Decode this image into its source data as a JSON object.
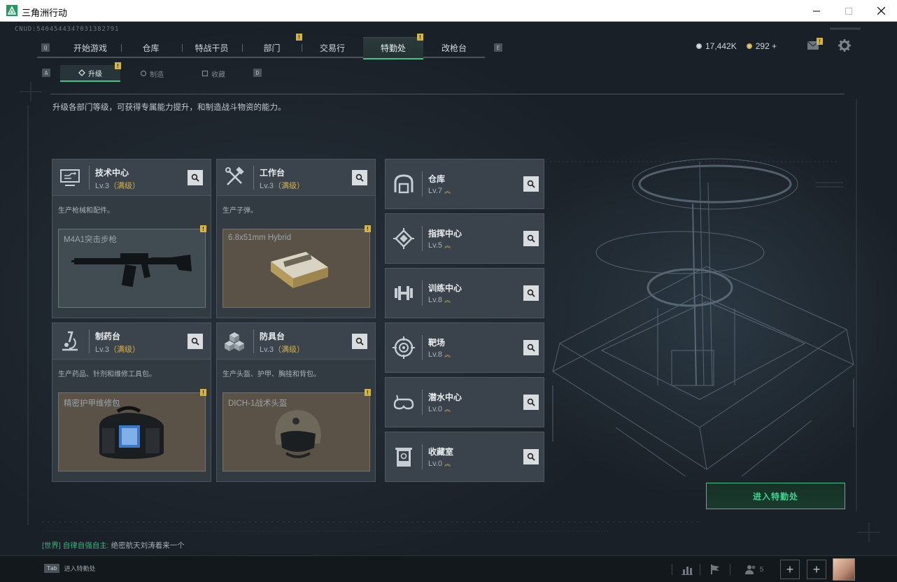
{
  "window": {
    "title": "三角洲行动"
  },
  "header": {
    "cnud": "CNUD:540454434703138279​1",
    "nav_key_left": "Q",
    "nav_key_right": "E",
    "tabs": [
      {
        "label": "开始游戏",
        "active": false,
        "alert": false
      },
      {
        "label": "仓库",
        "active": false,
        "alert": false
      },
      {
        "label": "特战干员",
        "active": false,
        "alert": false
      },
      {
        "label": "部门",
        "active": false,
        "alert": true
      },
      {
        "label": "交易行",
        "active": false,
        "alert": false
      },
      {
        "label": "特勤处",
        "active": true,
        "alert": true
      },
      {
        "label": "改枪台",
        "active": false,
        "alert": false
      }
    ],
    "currency_silver": "17,442K",
    "currency_gold": "292",
    "currency_plus": "+",
    "alert_glyph": "!"
  },
  "subnav": {
    "key_left": "A",
    "key_right": "D",
    "tabs": [
      {
        "label": "升级",
        "active": true
      },
      {
        "label": "制造",
        "active": false
      },
      {
        "label": "收藏",
        "active": false
      }
    ]
  },
  "intro": "升级各部门等级，可获得专属能力提升，和制造战斗物资的能力。",
  "departments": [
    {
      "name": "技术中心",
      "level": "Lv.3",
      "maxed": "（满级）",
      "desc": "生产枪械和配件。",
      "product": "M4A1突击步枪",
      "icon": "monitor-circuit-icon",
      "product_icon": "rifle-icon"
    },
    {
      "name": "工作台",
      "level": "Lv.3",
      "maxed": "（满级）",
      "desc": "生产子弹。",
      "product": "6.8x51mm Hybrid",
      "icon": "hammer-wrench-icon",
      "product_icon": "ammo-box-icon"
    },
    {
      "name": "制药台",
      "level": "Lv.3",
      "maxed": "（满级）",
      "desc": "生产药品、针剂和维修工具包。",
      "product": "精密护甲维修包",
      "icon": "microscope-icon",
      "product_icon": "repair-kit-icon"
    },
    {
      "name": "防具台",
      "level": "Lv.3",
      "maxed": "（满级）",
      "desc": "生产头盔、护甲、胸挂和背包。",
      "product": "DICH-1战术头盔",
      "icon": "armor-cubes-icon",
      "product_icon": "helmet-icon"
    }
  ],
  "rooms": [
    {
      "name": "仓库",
      "level": "Lv.7",
      "icon": "storage-arch-icon"
    },
    {
      "name": "指挥中心",
      "level": "Lv.5",
      "icon": "command-chip-icon"
    },
    {
      "name": "训练中心",
      "level": "Lv.8",
      "icon": "dumbbell-icon"
    },
    {
      "name": "靶场",
      "level": "Lv.8",
      "icon": "target-icon"
    },
    {
      "name": "潜水中心",
      "level": "Lv.0",
      "icon": "diving-mask-icon"
    },
    {
      "name": "收藏室",
      "level": "Lv.0",
      "icon": "collection-trophy-icon"
    }
  ],
  "up_glyph": "︽",
  "enter_button": "进入特勤处",
  "chat": {
    "channel": "[世界]",
    "user": "自律自强自主:",
    "message": "绝密航天刘涛着来一个"
  },
  "bottombar": {
    "tab_key": "Tab",
    "tab_label": "进入特勤处",
    "friends_count": "5",
    "plus": "+"
  },
  "colors": {
    "accent": "#40c48a",
    "maxed": "#d4b04a",
    "alert": "#d6b53a"
  }
}
